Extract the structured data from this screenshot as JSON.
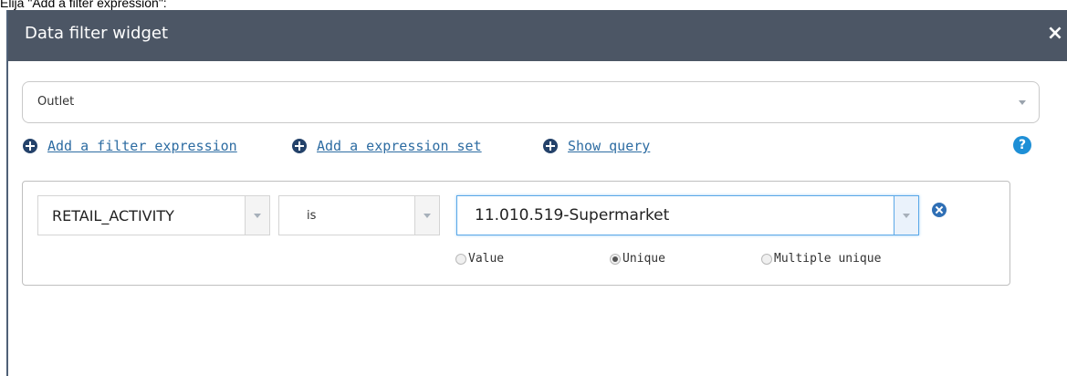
{
  "caption": "Elija \"Add a filter expression\":",
  "dialog": {
    "title": "Data filter widget",
    "close_glyph": "×"
  },
  "layer_select": {
    "value": "Outlet"
  },
  "actions": [
    {
      "label": "Add a filter expression",
      "icon": "plus-circle-icon"
    },
    {
      "label": "Add a expression set",
      "icon": "plus-circle-icon"
    },
    {
      "label": "Show query",
      "icon": "plus-circle-icon"
    }
  ],
  "help": {
    "glyph": "?",
    "icon": "help-icon"
  },
  "expression": {
    "field": "RETAIL_ACTIVITY",
    "operator": "is",
    "value": "11.010.519-Supermarket",
    "radios": [
      {
        "label": "Value",
        "selected": false
      },
      {
        "label": "Unique",
        "selected": true
      },
      {
        "label": "Multiple unique",
        "selected": false
      }
    ]
  },
  "colors": {
    "titlebar": "#4c5665",
    "link": "#2d6ca2",
    "accent": "#1e8fd6"
  }
}
